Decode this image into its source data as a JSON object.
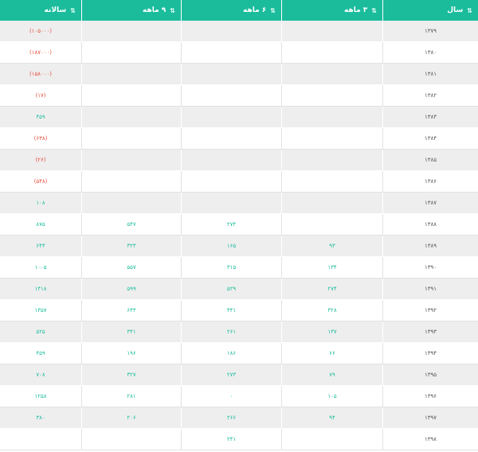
{
  "colors": {
    "header_bg": "#1abc9c",
    "value": "#1abc9c",
    "negative": "#e74c3c",
    "stripe": "#eeeeee"
  },
  "header": {
    "year": "سال",
    "m3": "۳ ماهه",
    "m6": "۶ ماهه",
    "m9": "۹ ماهه",
    "annual": "سالانه"
  },
  "rows": [
    {
      "year": "۱۳۷۹",
      "m3": "",
      "m6": "",
      "m9": "",
      "annual": "(۱۰۵۰۰۰)",
      "neg": true
    },
    {
      "year": "۱۳۸۰",
      "m3": "",
      "m6": "",
      "m9": "",
      "annual": "(۱۸۷۰۰۰)",
      "neg": true
    },
    {
      "year": "۱۳۸۱",
      "m3": "",
      "m6": "",
      "m9": "",
      "annual": "(۱۵۸۰۰۰)",
      "neg": true
    },
    {
      "year": "۱۳۸۲",
      "m3": "",
      "m6": "",
      "m9": "",
      "annual": "(۱۷)",
      "neg": true
    },
    {
      "year": "۱۳۸۳",
      "m3": "",
      "m6": "",
      "m9": "",
      "annual": "۴۵۹",
      "neg": false
    },
    {
      "year": "۱۳۸۴",
      "m3": "",
      "m6": "",
      "m9": "",
      "annual": "(۶۳۸)",
      "neg": true
    },
    {
      "year": "۱۳۸۵",
      "m3": "",
      "m6": "",
      "m9": "",
      "annual": "(۲۶)",
      "neg": true
    },
    {
      "year": "۱۳۸۶",
      "m3": "",
      "m6": "",
      "m9": "",
      "annual": "(۵۴۸)",
      "neg": true
    },
    {
      "year": "۱۳۸۷",
      "m3": "",
      "m6": "",
      "m9": "",
      "annual": "۱۰۸",
      "neg": false
    },
    {
      "year": "۱۳۸۸",
      "m3": "",
      "m6": "۲۷۴",
      "m9": "۵۴۷",
      "annual": "۸۷۵",
      "neg": false
    },
    {
      "year": "۱۳۸۹",
      "m3": "۹۳",
      "m6": "۱۶۵",
      "m9": "۳۲۳",
      "annual": "۶۴۳",
      "neg": false
    },
    {
      "year": "۱۳۹۰",
      "m3": "۱۳۴",
      "m6": "۳۱۵",
      "m9": "۵۵۷",
      "annual": "۱۰۰۵",
      "neg": false
    },
    {
      "year": "۱۳۹۱",
      "m3": "۲۷۴",
      "m6": "۵۲۹",
      "m9": "۵۹۹",
      "annual": "۱۴۱۸",
      "neg": false
    },
    {
      "year": "۱۳۹۲",
      "m3": "۳۲۸",
      "m6": "۴۴۱",
      "m9": "۶۴۳",
      "annual": "۱۳۵۷",
      "neg": false
    },
    {
      "year": "۱۳۹۳",
      "m3": "۱۳۷",
      "m6": "۲۶۱",
      "m9": "۳۴۱",
      "annual": "۵۲۵",
      "neg": false
    },
    {
      "year": "۱۳۹۴",
      "m3": "۶۶",
      "m6": "۱۸۶",
      "m9": "۱۹۶",
      "annual": "۴۵۹",
      "neg": false
    },
    {
      "year": "۱۳۹۵",
      "m3": "۷۹",
      "m6": "۲۷۳",
      "m9": "۳۲۷",
      "annual": "۷۰۸",
      "neg": false
    },
    {
      "year": "۱۳۹۶",
      "m3": "۱۰۵",
      "m6": "۰",
      "m9": "۲۸۱",
      "annual": "۱۲۵۸",
      "neg": false
    },
    {
      "year": "۱۳۹۷",
      "m3": "۹۴",
      "m6": "۲۶۶",
      "m9": "۲۰۶",
      "annual": "۳۸۰",
      "neg": false
    },
    {
      "year": "۱۳۹۸",
      "m3": "",
      "m6": "۲۴۱",
      "m9": "",
      "annual": "",
      "neg": false
    }
  ]
}
